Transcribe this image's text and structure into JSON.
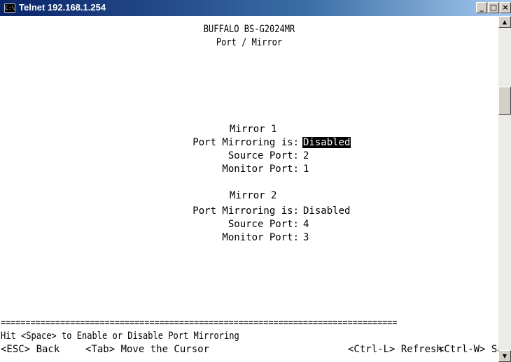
{
  "window": {
    "title": "Telnet 192.168.1.254",
    "icon": "console-icon",
    "icon_text": "C:\\",
    "buttons": {
      "minimize": "_",
      "maximize": "□",
      "close": "×"
    }
  },
  "screen": {
    "header": {
      "device": "BUFFALO BS-G2024MR",
      "page": "Port / Mirror"
    },
    "mirrors": [
      {
        "title": "Mirror 1",
        "mirroring_label": "Port Mirroring is:",
        "mirroring_value": "Disabled",
        "source_label": "Source Port:",
        "source_value": "2",
        "monitor_label": "Monitor Port:",
        "monitor_value": "1"
      },
      {
        "title": "Mirror 2",
        "mirroring_label": "Port Mirroring is:",
        "mirroring_value": "Disabled",
        "source_label": "Source Port:",
        "source_value": "4",
        "monitor_label": "Monitor Port:",
        "monitor_value": "3"
      }
    ],
    "separator": "================================================================================",
    "help_line": "Hit <Space> to Enable or Disable Port Mirroring",
    "footer": {
      "back": "<ESC> Back",
      "tab": "<Tab> Move the Cursor",
      "refresh": "<Ctrl-L> Refresh",
      "save": "<Ctrl-W> Save"
    }
  },
  "scrollbar": {
    "up_arrow": "▲",
    "down_arrow": "▼"
  }
}
